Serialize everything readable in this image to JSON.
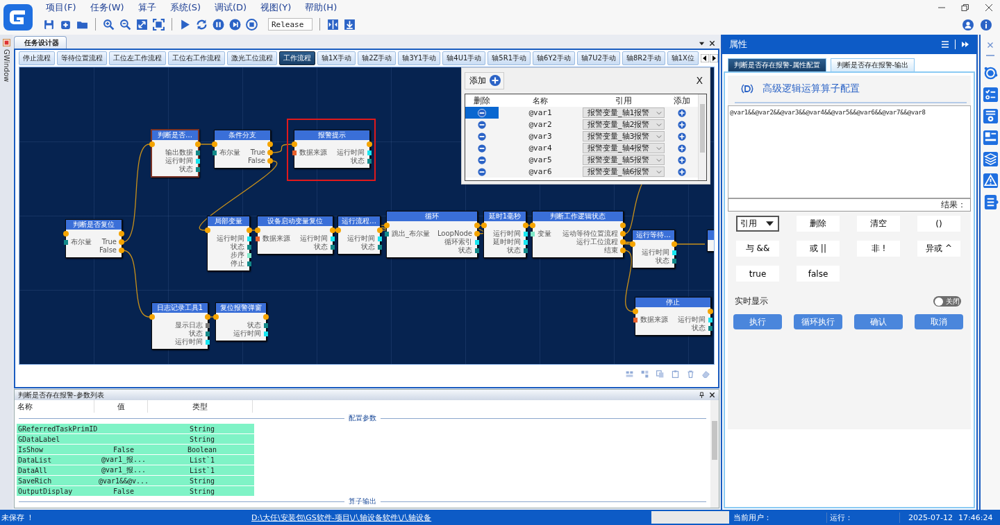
{
  "menu": [
    "项目(F)",
    "任务(W)",
    "算子",
    "系统(S)",
    "调试(D)",
    "视图(Y)",
    "帮助(H)"
  ],
  "toolbar": {
    "build_config": "Release"
  },
  "side_tab": "GWindow",
  "designer": {
    "title": "任务设计器",
    "tabs": [
      {
        "label": "停止流程",
        "selected": false
      },
      {
        "label": "等待位置流程",
        "selected": false
      },
      {
        "label": "工位左工作流程",
        "selected": false
      },
      {
        "label": "工位右工作流程",
        "selected": false
      },
      {
        "label": "激光工位流程",
        "selected": false
      },
      {
        "label": "工作流程",
        "selected": true
      },
      {
        "label": "轴1X手动",
        "selected": false
      },
      {
        "label": "轴2Z手动",
        "selected": false
      },
      {
        "label": "轴3Y1手动",
        "selected": false
      },
      {
        "label": "轴4U1手动",
        "selected": false
      },
      {
        "label": "轴5R1手动",
        "selected": false
      },
      {
        "label": "轴6Y2手动",
        "selected": false
      },
      {
        "label": "轴7U2手动",
        "selected": false
      },
      {
        "label": "轴8R2手动",
        "selected": false
      },
      {
        "label": "轴1X位",
        "selected": false
      }
    ],
    "nodes": [
      {
        "title": "判断是否复位",
        "selected": false,
        "highlighted": false,
        "inputs": [
          {
            "label": "布尔量",
            "color": "#138a8a"
          }
        ],
        "outputs": [
          {
            "label": "True",
            "kind": "branch"
          },
          {
            "label": "False",
            "kind": "branch"
          }
        ]
      },
      {
        "title": "判断是否…",
        "selected": true,
        "highlighted": false,
        "outputs": [
          {
            "label": "输出数据",
            "kind": "data",
            "color": "#138a8a"
          },
          {
            "label": "运行时间",
            "kind": "data",
            "color": "#19e6f0"
          },
          {
            "label": "状态",
            "kind": "data",
            "color": "#138a8a"
          }
        ]
      },
      {
        "title": "条件分支",
        "selected": false,
        "highlighted": false,
        "inputs": [
          {
            "label": "布尔量",
            "color": "#138a8a"
          }
        ],
        "outputs": [
          {
            "label": "True",
            "kind": "branch"
          },
          {
            "label": "False",
            "kind": "branch"
          }
        ]
      },
      {
        "title": "报警提示",
        "selected": false,
        "highlighted": true,
        "inputs": [
          {
            "label": "数据来源",
            "color": "#e8602c"
          }
        ],
        "outputs": [
          {
            "label": "运行时间",
            "kind": "data",
            "color": "#19e6f0"
          },
          {
            "label": "状态",
            "kind": "data",
            "color": "#138a8a"
          }
        ]
      },
      {
        "title": "局部变量",
        "selected": false,
        "highlighted": false,
        "outputs": [
          {
            "label": "运行时间",
            "kind": "data",
            "color": "#19e6f0"
          },
          {
            "label": "状态",
            "kind": "data",
            "color": "#138a8a"
          },
          {
            "label": "步序",
            "kind": "data",
            "color": "#7fe8c8"
          },
          {
            "label": "停止",
            "kind": "data",
            "color": "#138a8a"
          }
        ]
      },
      {
        "title": "设备启动变量复位",
        "selected": false,
        "highlighted": false,
        "inputs": [
          {
            "label": "数据来源",
            "color": "#e8602c"
          }
        ],
        "outputs": [
          {
            "label": "运行时间",
            "kind": "data",
            "color": "#19e6f0"
          },
          {
            "label": "状态",
            "kind": "data",
            "color": "#138a8a"
          }
        ]
      },
      {
        "title": "运行流程…",
        "selected": false,
        "highlighted": false,
        "outputs": [
          {
            "label": "运行时间",
            "kind": "data",
            "color": "#19e6f0"
          },
          {
            "label": "状态",
            "kind": "data",
            "color": "#138a8a"
          }
        ]
      },
      {
        "title": "循环",
        "selected": false,
        "highlighted": false,
        "inputs": [
          {
            "label": "跳出_布尔量",
            "color": "#138a8a"
          }
        ],
        "outputs": [
          {
            "label": "LoopNode",
            "kind": "branch"
          },
          {
            "label": "循环索引",
            "kind": "data",
            "color": "#19e6f0"
          },
          {
            "label": "状态",
            "kind": "data",
            "color": "#138a8a"
          }
        ]
      },
      {
        "title": "延时1毫秒",
        "selected": false,
        "highlighted": false,
        "outputs": [
          {
            "label": "运行时间",
            "kind": "data",
            "color": "#19e6f0"
          },
          {
            "label": "延时时间",
            "kind": "data",
            "color": "#19e6f0"
          },
          {
            "label": "状态",
            "kind": "data",
            "color": "#138a8a"
          }
        ]
      },
      {
        "title": "判断工作逻辑状态",
        "selected": false,
        "highlighted": false,
        "inputs": [
          {
            "label": "变量",
            "color": "#7fe8c8"
          }
        ],
        "outputs": [
          {
            "label": "运动等待位置流程",
            "kind": "branch"
          },
          {
            "label": "运行工位流程",
            "kind": "branch"
          },
          {
            "label": "结束",
            "kind": "branch"
          }
        ]
      },
      {
        "title": "运行等待…",
        "selected": false,
        "highlighted": false,
        "outputs": [
          {
            "label": "运行时间",
            "kind": "data",
            "color": "#19e6f0"
          },
          {
            "label": "状态",
            "kind": "data",
            "color": "#138a8a"
          }
        ]
      },
      {
        "selected": false,
        "highlighted": false
      },
      {
        "title": "停止",
        "selected": false,
        "highlighted": false,
        "inputs": [
          {
            "label": "数据来源",
            "color": "#e8602c"
          }
        ],
        "outputs": [
          {
            "label": "运行时间",
            "kind": "data",
            "color": "#19e6f0"
          },
          {
            "label": "状态",
            "kind": "data",
            "color": "#138a8a"
          }
        ]
      },
      {
        "title": "日志记录工具1",
        "selected": false,
        "highlighted": false,
        "outputs": [
          {
            "label": "显示日志",
            "kind": "data",
            "color": "#777777"
          },
          {
            "label": "状态",
            "kind": "data",
            "color": "#138a8a"
          },
          {
            "label": "运行时间",
            "kind": "data",
            "color": "#19e6f0"
          }
        ]
      },
      {
        "title": "复位报警弹窗",
        "selected": false,
        "highlighted": false,
        "outputs": [
          {
            "label": "状态",
            "kind": "data",
            "color": "#138a8a"
          },
          {
            "label": "运行时间",
            "kind": "data",
            "color": "#19e6f0"
          }
        ]
      }
    ],
    "popup": {
      "add_label": "添加",
      "close": "X",
      "columns": [
        "删除",
        "名称",
        "引用",
        "添加"
      ],
      "rows": [
        {
          "name": "@var1",
          "reference": "报警变量_轴1报警",
          "selected": true
        },
        {
          "name": "@var2",
          "reference": "报警变量_轴2报警",
          "selected": false
        },
        {
          "name": "@var3",
          "reference": "报警变量_轴3报警",
          "selected": false
        },
        {
          "name": "@var4",
          "reference": "报警变量_轴4报警",
          "selected": false
        },
        {
          "name": "@var5",
          "reference": "报警变量_轴5报警",
          "selected": false
        },
        {
          "name": "@var6",
          "reference": "报警变量_轴6报警",
          "selected": false
        }
      ]
    }
  },
  "params_panel": {
    "title": "判断是否存在报警-参数列表",
    "columns": [
      "名称",
      "值",
      "类型"
    ],
    "config_label": "配置参数",
    "rows": [
      {
        "name": "GReferredTaskPrimID",
        "type": "String"
      },
      {
        "name": "GDataLabel",
        "type": "String"
      },
      {
        "name": "IsShow",
        "value": "False",
        "type": "Boolean"
      },
      {
        "name": "DataList",
        "value": "@var1_报...",
        "type": "List`1"
      },
      {
        "name": "DataAll",
        "value": "@var1_报...",
        "type": "List`1"
      },
      {
        "name": "SaveRich",
        "value": "@var1&&@v...",
        "type": "String"
      },
      {
        "name": "OutputDisplay",
        "value": "False",
        "type": "String"
      }
    ],
    "output_label": "算子输出"
  },
  "properties": {
    "title": "属性",
    "tabs": [
      {
        "label": "判断是否存在报警-属性配置",
        "selected": true
      },
      {
        "label": "判断是否存在报警-输出",
        "selected": false
      }
    ],
    "heading": "高级逻辑运算算子配置",
    "expression": "@var1&&@var2&&@var3&&@var4&&@var5&&@var6&&@var7&&@var8",
    "result_label": "结果：",
    "operators": [
      {
        "kind": "dropdown",
        "label": "引用"
      },
      {
        "kind": "button",
        "label": "删除"
      },
      {
        "kind": "button",
        "label": "清空"
      },
      {
        "kind": "button",
        "label": "()"
      },
      {
        "kind": "button",
        "label": "与 &&"
      },
      {
        "kind": "button",
        "label": "或 ||"
      },
      {
        "kind": "button",
        "label": "非 !"
      },
      {
        "kind": "button",
        "label": "异或 ^"
      },
      {
        "kind": "button",
        "label": "true"
      },
      {
        "kind": "button",
        "label": "false"
      }
    ],
    "realtime": {
      "label": "实时显示",
      "on": false,
      "state_label": "关闭"
    },
    "actions": [
      "执行",
      "循环执行",
      "确认",
      "取消"
    ]
  },
  "status_bar": {
    "save_state": "未保存 ！",
    "path": "D:\\大任\\安装包\\GS软件-项目\\八轴设备软件\\八轴设备",
    "user_label": "当前用户：",
    "run_label": "运行：",
    "date": "2025-07-12",
    "time": "17:46:24"
  }
}
